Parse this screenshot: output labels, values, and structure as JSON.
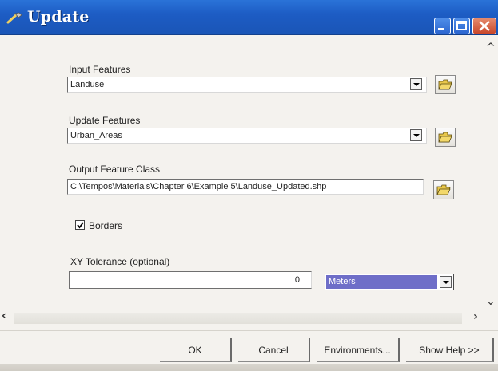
{
  "window": {
    "title": "Update"
  },
  "fields": {
    "input_features": {
      "label": "Input Features",
      "value": "Landuse"
    },
    "update_features": {
      "label": "Update Features",
      "value": "Urban_Areas"
    },
    "output_feature_class": {
      "label": "Output Feature Class",
      "value": "C:\\Tempos\\Materials\\Chapter 6\\Example 5\\Landuse_Updated.shp"
    },
    "borders": {
      "label": "Borders",
      "checked": true
    },
    "xy_tolerance": {
      "label": "XY Tolerance (optional)",
      "value": "0",
      "units": "Meters"
    }
  },
  "buttons": {
    "ok": "OK",
    "cancel": "Cancel",
    "environments": "Environments...",
    "show_help": "Show Help >>"
  },
  "icons": {
    "title": "tool-wrench-icon",
    "browse": "open-folder-icon",
    "dropdown": "chevron-down-icon"
  },
  "colors": {
    "titlebar": "#1d5cc4",
    "selection": "#6e6ec8",
    "close_button": "#c9472a"
  }
}
